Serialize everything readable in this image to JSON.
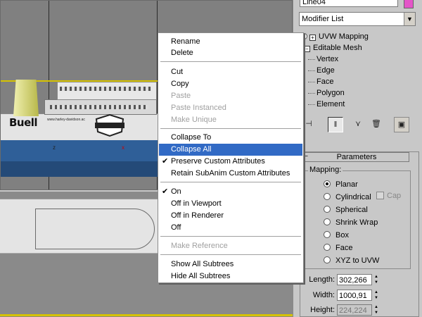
{
  "window": {
    "object_name": "Line04",
    "object_color": "#e455c8"
  },
  "viewport": {
    "brand_text": "Buell",
    "url_text": "www.harley-davidson.ac",
    "logo_text": "HARLEY-DAVIDSON",
    "marker_z": "z",
    "marker_x": "x"
  },
  "context_menu": {
    "items": [
      {
        "label": "Rename",
        "enabled": true,
        "checked": false
      },
      {
        "label": "Delete",
        "enabled": true,
        "checked": false
      },
      {
        "label": "Cut",
        "enabled": true,
        "checked": false
      },
      {
        "label": "Copy",
        "enabled": true,
        "checked": false
      },
      {
        "label": "Paste",
        "enabled": false,
        "checked": false
      },
      {
        "label": "Paste Instanced",
        "enabled": false,
        "checked": false
      },
      {
        "label": "Make Unique",
        "enabled": false,
        "checked": false
      },
      {
        "label": "Collapse To",
        "enabled": true,
        "checked": false
      },
      {
        "label": "Collapse All",
        "enabled": true,
        "checked": false,
        "highlighted": true
      },
      {
        "label": "Preserve Custom Attributes",
        "enabled": true,
        "checked": true
      },
      {
        "label": "Retain SubAnim Custom Attributes",
        "enabled": true,
        "checked": false
      },
      {
        "label": "On",
        "enabled": true,
        "checked": true
      },
      {
        "label": "Off in Viewport",
        "enabled": true,
        "checked": false
      },
      {
        "label": "Off in Renderer",
        "enabled": true,
        "checked": false
      },
      {
        "label": "Off",
        "enabled": true,
        "checked": false
      },
      {
        "label": "Make Reference",
        "enabled": false,
        "checked": false
      },
      {
        "label": "Show All Subtrees",
        "enabled": true,
        "checked": false
      },
      {
        "label": "Hide All Subtrees",
        "enabled": true,
        "checked": false
      }
    ],
    "check_glyph": "✔"
  },
  "command_panel": {
    "modifier_list": "Modifier List",
    "stack": {
      "modifier": "UVW Mapping",
      "base": "Editable Mesh",
      "sub_objects": [
        "Vertex",
        "Edge",
        "Face",
        "Polygon",
        "Element"
      ]
    },
    "rollout_title": "Parameters",
    "mapping": {
      "label": "Mapping:",
      "options": [
        "Planar",
        "Cylindrical",
        "Spherical",
        "Shrink Wrap",
        "Box",
        "Face",
        "XYZ to UVW"
      ],
      "selected": "Planar",
      "cap_label": "Cap"
    },
    "dimensions": [
      {
        "label": "Length:",
        "value": "302,266",
        "enabled": true
      },
      {
        "label": "Width:",
        "value": "1000,91",
        "enabled": true
      },
      {
        "label": "Height:",
        "value": "224,224",
        "enabled": false
      }
    ]
  }
}
